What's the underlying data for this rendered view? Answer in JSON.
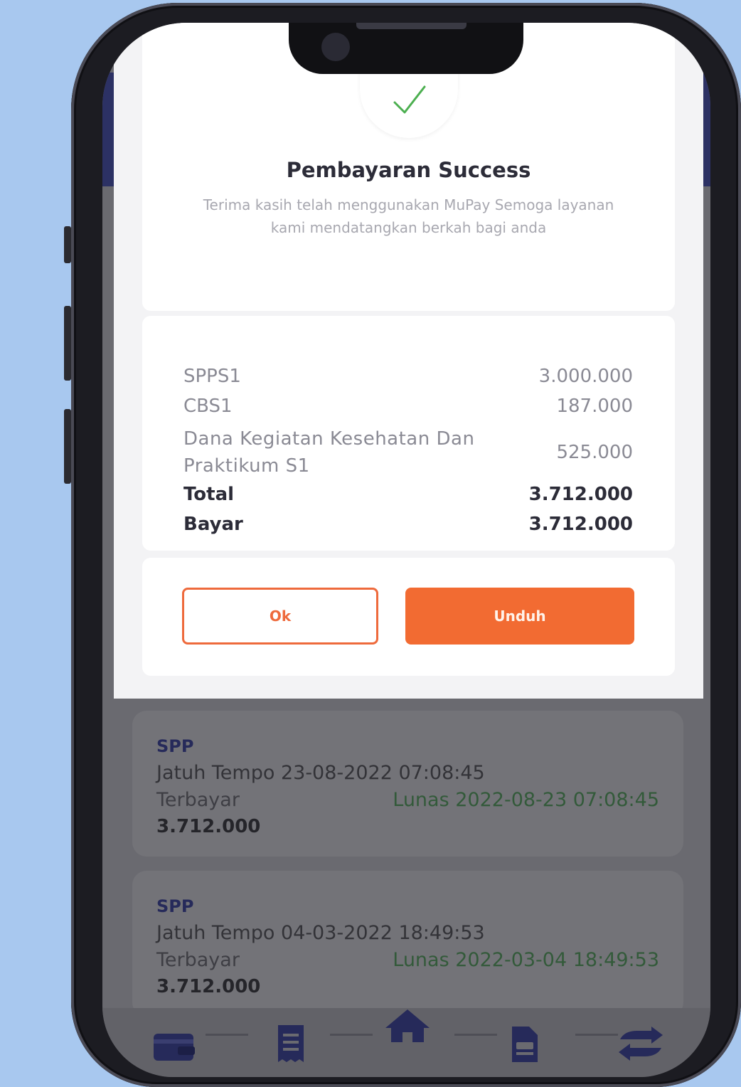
{
  "modal": {
    "title": "Pembayaran Success",
    "subtitle": "Terima kasih telah menggunakan MuPay Semoga layanan kami mendatangkan berkah bagi anda",
    "items": [
      {
        "label": "SPPS1",
        "amount": "3.000.000"
      },
      {
        "label": "CBS1",
        "amount": "187.000"
      },
      {
        "label": "Dana Kegiatan Kesehatan Dan Praktikum S1",
        "amount": "525.000"
      }
    ],
    "total_label": "Total",
    "total_amount": "3.712.000",
    "bayar_label": "Bayar",
    "bayar_amount": "3.712.000",
    "ok_label": "Ok",
    "download_label": "Unduh"
  },
  "payments": [
    {
      "name": "SPP",
      "due": "Jatuh Tempo 23-08-2022 07:08:45",
      "paid_label": "Terbayar",
      "paid_status": "Lunas 2022-08-23 07:08:45",
      "amount": "3.712.000"
    },
    {
      "name": "SPP",
      "due": "Jatuh Tempo 04-03-2022 18:49:53",
      "paid_label": "Terbayar",
      "paid_status": "Lunas 2022-03-04 18:49:53",
      "amount": "3.712.000"
    }
  ],
  "nav": [
    "wallet-icon",
    "receipt-icon",
    "home-icon",
    "document-icon",
    "transfer-icon"
  ],
  "colors": {
    "accent": "#f26b32",
    "navy": "#262a5a",
    "success": "#4caf50"
  }
}
